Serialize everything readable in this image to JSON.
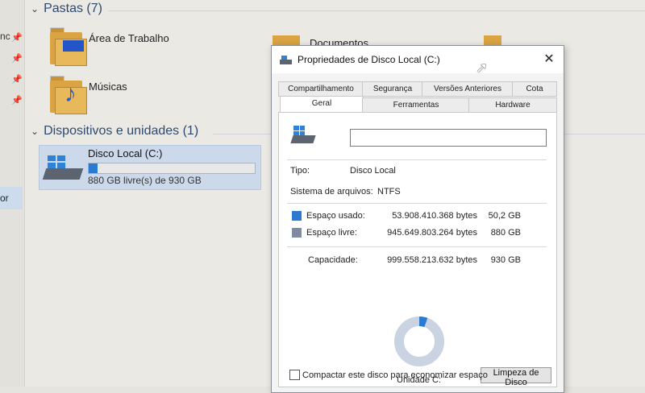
{
  "explorer": {
    "groups": {
      "folders_header": "Pastas (7)",
      "devices_header": "Dispositivos e unidades (1)"
    },
    "folders": [
      {
        "label": "Área de Trabalho"
      },
      {
        "label": "Músicas"
      },
      {
        "label": "Documentos"
      }
    ],
    "left_pane": {
      "items": [
        "nc"
      ],
      "selected_fragment": "or"
    },
    "drive": {
      "name": "Disco Local (C:)",
      "free_text": "880 GB livre(s) de 930 GB",
      "used_fraction": 0.054
    }
  },
  "dialog": {
    "title": "Propriedades de Disco Local (C:)",
    "close_glyph": "✕",
    "tabs_row1": [
      "Compartilhamento",
      "Segurança",
      "Versões Anteriores",
      "Cota"
    ],
    "tabs_row2": [
      "Geral",
      "Ferramentas",
      "Hardware"
    ],
    "active_tab": "Geral",
    "name_value": "",
    "type_label": "Tipo:",
    "type_value": "Disco Local",
    "fs_label": "Sistema de arquivos:",
    "fs_value": "NTFS",
    "used_label": "Espaço usado:",
    "used_bytes": "53.908.410.368 bytes",
    "used_gb": "50,2 GB",
    "free_label": "Espaço livre:",
    "free_bytes": "945.649.803.264 bytes",
    "free_gb": "880 GB",
    "capacity_label": "Capacidade:",
    "capacity_bytes": "999.558.213.632 bytes",
    "capacity_gb": "930 GB",
    "drive_label": "Unidade C:",
    "cleanup_button": "Limpeza de Disco",
    "compress_label": "Compactar este disco para economizar espaço",
    "colors": {
      "used": "#2a7ad2",
      "free": "#7f8aa0"
    }
  }
}
